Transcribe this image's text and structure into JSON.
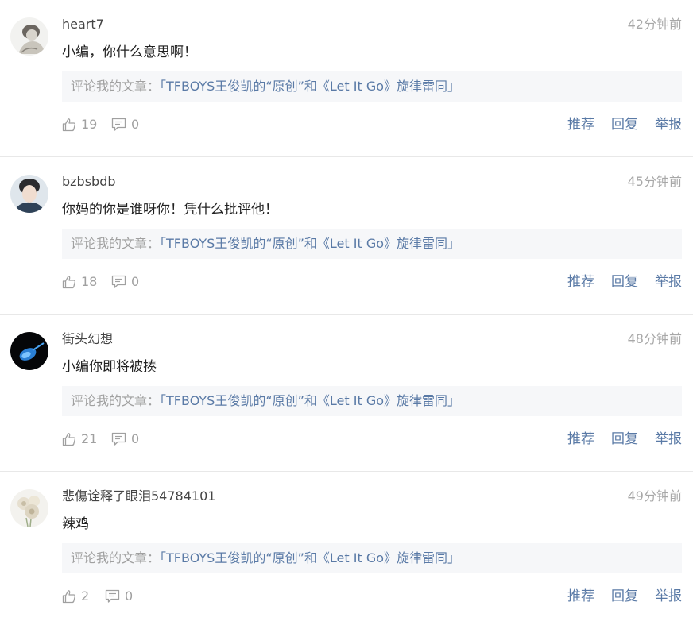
{
  "article_prefix": "评论我的文章：",
  "article_title": "「TFBOYS王俊凯的“原创”和《Let It Go》旋律雷同」",
  "actions": {
    "recommend": "推荐",
    "reply": "回复",
    "report": "举报"
  },
  "comments": [
    {
      "username": "heart7",
      "time": "42分钟前",
      "content": "小编，你什么意思啊！",
      "likes": "19",
      "replies": "0"
    },
    {
      "username": "bzbsbdb",
      "time": "45分钟前",
      "content": "你妈的你是谁呀你！凭什么批评他！",
      "likes": "18",
      "replies": "0"
    },
    {
      "username": "街头幻想",
      "time": "48分钟前",
      "content": "小编你即将被揍",
      "likes": "21",
      "replies": "0"
    },
    {
      "username": "悲傷诠释了眼泪54784101",
      "time": "49分钟前",
      "content": "辣鸡",
      "likes": "2",
      "replies": "0"
    }
  ],
  "avatar_icons": [
    "avatar-sketch-girl-icon",
    "avatar-young-man-icon",
    "avatar-blue-violin-icon",
    "avatar-flower-bouquet-icon"
  ]
}
